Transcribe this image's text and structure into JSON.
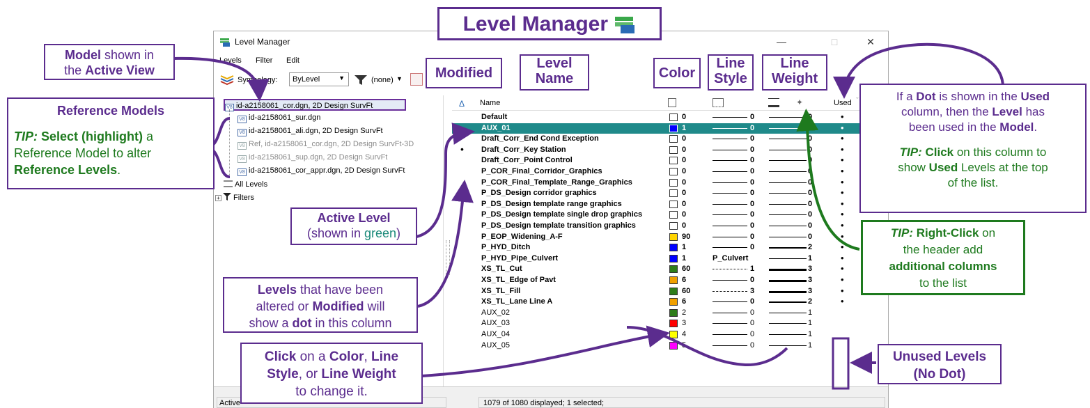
{
  "header": {
    "title": "Level Manager"
  },
  "window": {
    "title": "Level Manager",
    "minimize": "—",
    "maximize": "□",
    "close": "✕"
  },
  "menu": {
    "levels": "Levels",
    "filter": "Filter",
    "edit": "Edit"
  },
  "toolbar": {
    "symbology_label": "Symbology:",
    "symbology_value": "ByLevel",
    "filter_value": "(none)"
  },
  "tree": {
    "items": [
      {
        "label": "id-a2158061_cor.dgn, 2D Design SurvFt",
        "selected": true
      },
      {
        "label": "id-a2158061_sur.dgn"
      },
      {
        "label": "id-a2158061_ali.dgn, 2D Design SurvFt"
      },
      {
        "label": "Ref, id-a2158061_cor.dgn, 2D Design SurvFt-3D",
        "gray": true
      },
      {
        "label": "id-a2158061_sup.dgn, 2D Design SurvFt",
        "gray": true
      },
      {
        "label": "id-a2158061_cor_appr.dgn, 2D Design SurvFt"
      }
    ],
    "all_levels": "All Levels",
    "filters": "Filters"
  },
  "list": {
    "headers": {
      "modified": "Δ",
      "name": "Name",
      "used": "Used"
    },
    "rows": [
      {
        "name": "Default",
        "mod": "",
        "color": "#ffffff",
        "color_num": "0",
        "ls": "0",
        "ls_style": "solid",
        "lw": "0",
        "used": "•"
      },
      {
        "name": "AUX_01",
        "mod": "",
        "color": "#0000ff",
        "color_num": "1",
        "ls": "0",
        "ls_style": "solid",
        "lw": "0",
        "used": "•",
        "active": true
      },
      {
        "name": "Draft_Corr_End Cond Exception",
        "mod": "",
        "color": "#ffffff",
        "color_num": "0",
        "ls": "0",
        "ls_style": "solid",
        "lw": "0",
        "used": "•"
      },
      {
        "name": "Draft_Corr_Key Station",
        "mod": "•",
        "color": "#ffffff",
        "color_num": "0",
        "ls": "0",
        "ls_style": "solid",
        "lw": "0",
        "used": "•"
      },
      {
        "name": "Draft_Corr_Point Control",
        "mod": "",
        "color": "#ffffff",
        "color_num": "0",
        "ls": "0",
        "ls_style": "solid",
        "lw": "0",
        "used": "•"
      },
      {
        "name": "P_COR_Final_Corridor_Graphics",
        "mod": "",
        "color": "#ffffff",
        "color_num": "0",
        "ls": "0",
        "ls_style": "solid",
        "lw": "0",
        "used": "•"
      },
      {
        "name": "P_COR_Final_Template_Range_Graphics",
        "mod": "",
        "color": "#ffffff",
        "color_num": "0",
        "ls": "0",
        "ls_style": "solid",
        "lw": "0",
        "used": "•"
      },
      {
        "name": "P_DS_Design corridor graphics",
        "mod": "•",
        "color": "#ffffff",
        "color_num": "0",
        "ls": "0",
        "ls_style": "solid",
        "lw": "0",
        "used": "•"
      },
      {
        "name": "P_DS_Design template range graphics",
        "mod": "•",
        "color": "#ffffff",
        "color_num": "0",
        "ls": "0",
        "ls_style": "solid",
        "lw": "0",
        "used": "•"
      },
      {
        "name": "P_DS_Design template single drop graphics",
        "mod": "",
        "color": "#ffffff",
        "color_num": "0",
        "ls": "0",
        "ls_style": "solid",
        "lw": "0",
        "used": "•"
      },
      {
        "name": "P_DS_Design template transition graphics",
        "mod": "",
        "color": "#ffffff",
        "color_num": "0",
        "ls": "0",
        "ls_style": "solid",
        "lw": "0",
        "used": "•"
      },
      {
        "name": "P_EOP_Widening_A-F",
        "mod": "",
        "color": "#ffd400",
        "color_num": "90",
        "ls": "0",
        "ls_style": "solid",
        "lw": "0",
        "used": "•"
      },
      {
        "name": "P_HYD_Ditch",
        "mod": "",
        "color": "#0000ff",
        "color_num": "1",
        "ls": "0",
        "ls_style": "solid",
        "lw": "2",
        "used": "•"
      },
      {
        "name": "P_HYD_Pipe_Culvert",
        "mod": "",
        "color": "#0000ff",
        "color_num": "1",
        "ls_text": "P_Culvert",
        "lw": "1",
        "used": "•"
      },
      {
        "name": "XS_TL_Cut",
        "mod": "",
        "color": "#2e7d1a",
        "color_num": "60",
        "ls": "1",
        "ls_style": "dot",
        "lw": "3",
        "used": "•"
      },
      {
        "name": "XS_TL_Edge of Pavt",
        "mod": "",
        "color": "#f0a000",
        "color_num": "6",
        "ls": "0",
        "ls_style": "solid",
        "lw": "3",
        "used": "•"
      },
      {
        "name": "XS_TL_Fill",
        "mod": "",
        "color": "#2e7d1a",
        "color_num": "60",
        "ls": "3",
        "ls_style": "dash",
        "lw": "3",
        "used": "•"
      },
      {
        "name": "XS_TL_Lane Line A",
        "mod": "",
        "color": "#f0a000",
        "color_num": "6",
        "ls": "0",
        "ls_style": "solid",
        "lw": "2",
        "used": "•"
      },
      {
        "name": "AUX_02",
        "mod": "",
        "color": "#2e7d1a",
        "color_num": "2",
        "ls": "0",
        "ls_style": "solid",
        "lw": "1",
        "used": "",
        "unused": true
      },
      {
        "name": "AUX_03",
        "mod": "",
        "color": "#ff0000",
        "color_num": "3",
        "ls": "0",
        "ls_style": "solid",
        "lw": "1",
        "used": "",
        "unused": true
      },
      {
        "name": "AUX_04",
        "mod": "",
        "color": "#ffff00",
        "color_num": "4",
        "ls": "0",
        "ls_style": "solid",
        "lw": "1",
        "used": "",
        "unused": true
      },
      {
        "name": "AUX_05",
        "mod": "",
        "color": "#ff00ff",
        "color_num": "5",
        "ls": "0",
        "ls_style": "solid",
        "lw": "1",
        "used": "",
        "unused": true
      }
    ]
  },
  "status": {
    "left": "Active",
    "right": "1079 of 1080 displayed; 1 selected;"
  },
  "callouts": {
    "model_active_view": {
      "l1a": "Model",
      "l1b": " shown in",
      "l2a": "the ",
      "l2b": "Active View"
    },
    "reference_models": {
      "title": "Reference Models",
      "tip": "TIP:",
      "t1": " Select (highlight)",
      "t2": " a",
      "t3": "Reference Model to alter",
      "t4": "Reference Levels",
      "t5": "."
    },
    "modified": "Modified",
    "level_name": {
      "l1": "Level",
      "l2": "Name"
    },
    "color": "Color",
    "line_style": {
      "l1": "Line",
      "l2": "Style"
    },
    "line_weight": {
      "l1": "Line",
      "l2": "Weight"
    },
    "used_dot": {
      "a1": "If a ",
      "a2": "Dot",
      "a3": " is shown in the ",
      "a4": "Used",
      "b1": "column, then the ",
      "b2": "Level",
      "b3": " has",
      "c1": "been used in the ",
      "c2": "Model",
      "c3": ".",
      "d1": "TIP:",
      "d2": " Click",
      "d3": " on this column to",
      "e1": "show ",
      "e2": "Used",
      "e3": " Levels at the top",
      "f1": "of the list."
    },
    "active_level": {
      "l1": "Active Level",
      "l2a": "(shown in ",
      "l2b": "green",
      "l2c": ")"
    },
    "levels_modified": {
      "a1": "Levels",
      "a2": " that have been",
      "b1": "altered or ",
      "b2": "Modified",
      "b3": " will",
      "c1": "show a ",
      "c2": "dot",
      "c3": " in this column"
    },
    "right_click": {
      "a1": "TIP:",
      "a2": " Right-Click",
      "a3": " on",
      "b1": "the header add",
      "c1": "additional columns",
      "d1": "to the list"
    },
    "click_color": {
      "a1": "Click",
      "a2": " on a ",
      "a3": "Color",
      "a4": ", ",
      "a5": "Line",
      "b1": "Style",
      "b2": ", or ",
      "b3": "Line Weight",
      "c1": "to change it."
    },
    "unused_levels": {
      "l1": "Unused Levels",
      "l2": "(No Dot)"
    }
  },
  "colors": {
    "callout_purple": "#5b2c8e",
    "tip_green": "#1e7a1e",
    "active_row": "#1f8a8a"
  }
}
